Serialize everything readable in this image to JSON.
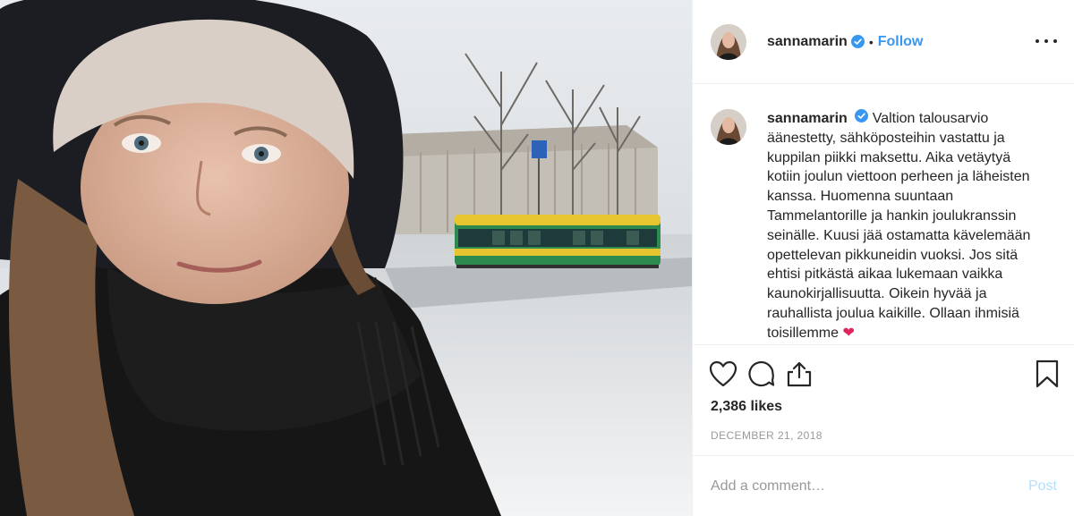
{
  "photo": {
    "alt": "selfie with tram in snowy Helsinki"
  },
  "header": {
    "username": "sannamarin",
    "separator": "•",
    "follow_label": "Follow",
    "more_icon": "more-options-icon"
  },
  "caption": {
    "username": "sannamarin",
    "text": "Valtion talousarvio äänestetty, sähköposteihin vastattu ja kuppilan piikki maksettu. Aika vetäytyä kotiin joulun viettoon perheen ja läheisten kanssa. Huomenna suuntaan Tammelantorille ja hankin joulukranssin seinälle. Kuusi jää ostamatta kävelemään opettelevan pikkuneidin vuoksi. Jos sitä ehtisi pitkästä aikaa lukemaan vaikka kaunokirjallisuutta. Oikein hyvää ja rauhallista joulua kaikille. Ollaan ihmisiä toisillemme",
    "emoji": "❤"
  },
  "actions": {
    "icons": [
      "heart-icon",
      "comment-icon",
      "share-icon",
      "bookmark-icon"
    ],
    "likes": "2,386 likes",
    "date": "DECEMBER 21, 2018"
  },
  "comment": {
    "placeholder": "Add a comment…",
    "post_label": "Post"
  },
  "colors": {
    "accent": "#3897f0",
    "verified": "#3897f0",
    "post_disabled": "#b2dffc",
    "tram_green": "#2e8b4f",
    "tram_yellow": "#e7c531"
  }
}
